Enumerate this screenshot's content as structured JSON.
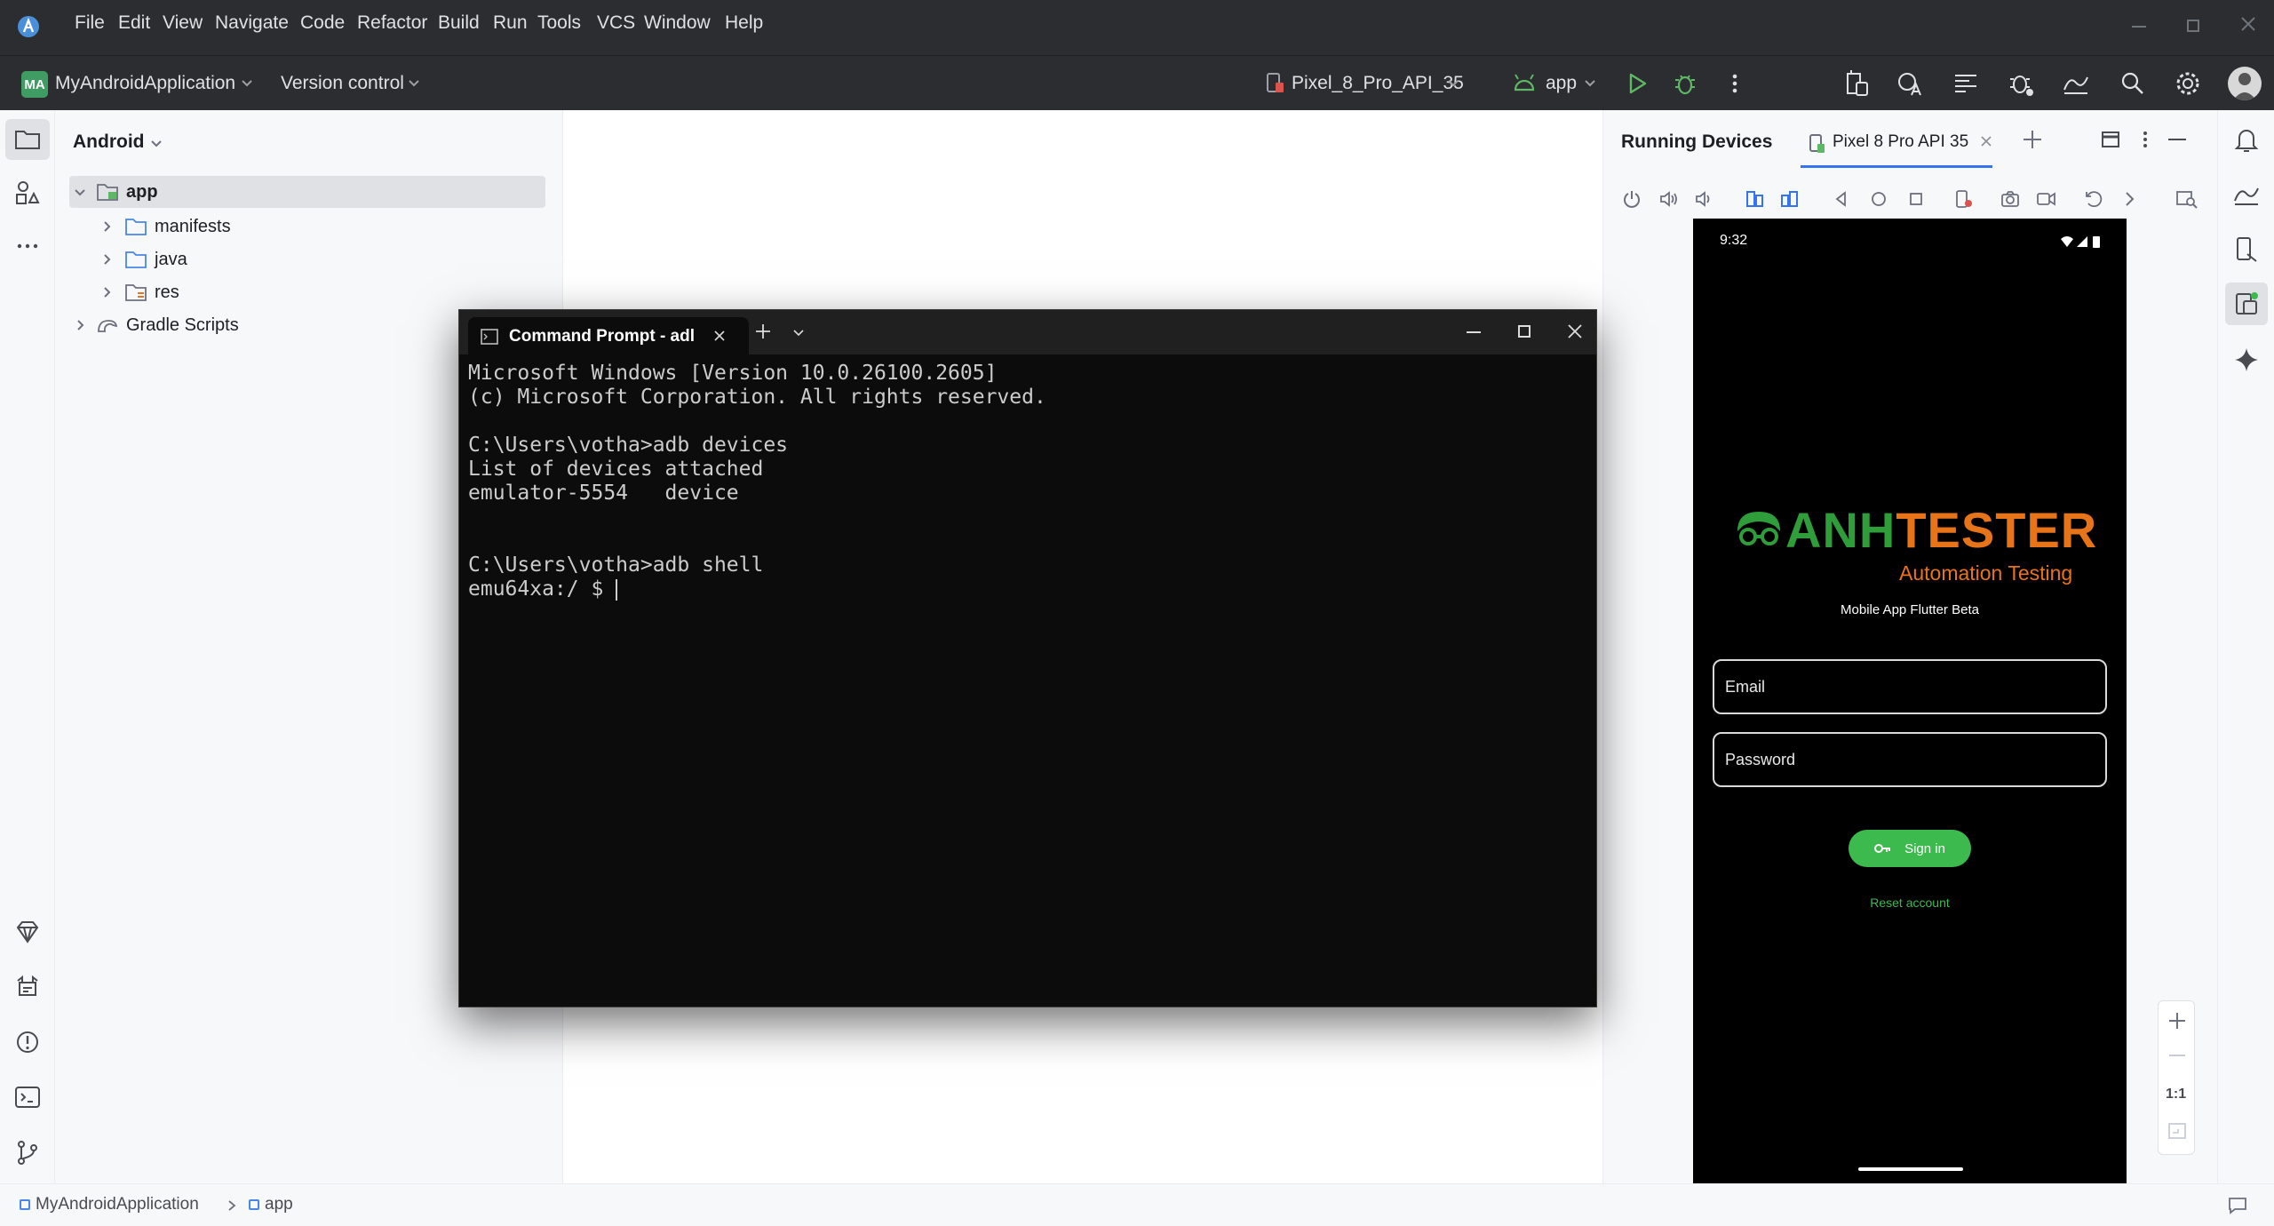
{
  "menu": [
    "File",
    "Edit",
    "View",
    "Navigate",
    "Code",
    "Refactor",
    "Build",
    "Run",
    "Tools",
    "VCS",
    "Window",
    "Help"
  ],
  "toolbar": {
    "project_badge": "MA",
    "project_name": "MyAndroidApplication",
    "version_control": "Version control",
    "device": "Pixel_8_Pro_API_35",
    "run_config": "app"
  },
  "project_panel": {
    "view_label": "Android",
    "tree": {
      "app": "app",
      "manifests": "manifests",
      "java": "java",
      "res": "res",
      "gradle": "Gradle Scripts"
    }
  },
  "running_devices": {
    "title": "Running Devices",
    "tab": "Pixel 8 Pro API 35",
    "zoom_label": "1:1"
  },
  "phone": {
    "time": "9:32",
    "logo_left": "ANH",
    "logo_right": "TESTER",
    "tagline": "Automation Testing",
    "subtitle": "Mobile App Flutter Beta",
    "email_placeholder": "Email",
    "password_placeholder": "Password",
    "sign_in": "Sign in",
    "reset": "Reset account"
  },
  "cmd": {
    "tab_title": "Command Prompt - adl",
    "lines": [
      "Microsoft Windows [Version 10.0.26100.2605]",
      "(c) Microsoft Corporation. All rights reserved.",
      "",
      "C:\\Users\\votha>adb devices",
      "List of devices attached",
      "emulator-5554   device",
      "",
      "",
      "C:\\Users\\votha>adb shell",
      "emu64xa:/ $ "
    ]
  },
  "statusbar": {
    "crumb1": "MyAndroidApplication",
    "crumb2": "app"
  },
  "colors": {
    "accent_green": "#3dba4e",
    "logo_green": "#2e9d3a",
    "logo_orange": "#e8741a"
  }
}
